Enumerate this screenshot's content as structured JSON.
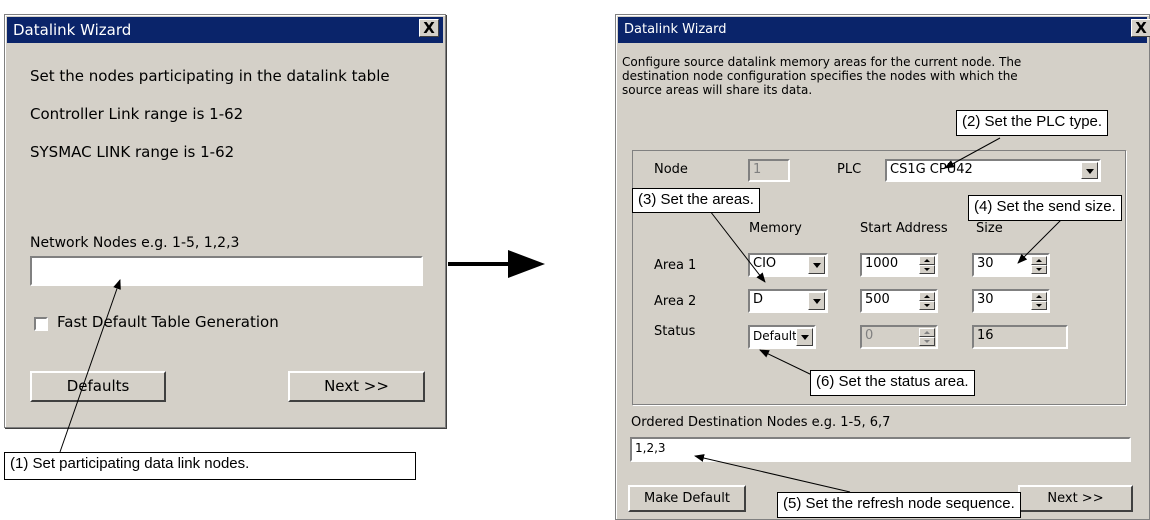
{
  "left_dialog": {
    "title": "Datalink Wizard",
    "close": "X",
    "line1": "Set the nodes participating in the datalink table",
    "line2": "Controller Link range is 1-62",
    "line3": "SYSMAC LINK range is 1-62",
    "network_nodes_label": "Network Nodes  e.g. 1-5, 1,2,3",
    "network_nodes_value": "",
    "fast_default_label": "Fast Default Table Generation",
    "fast_default_checked": false,
    "defaults_button": "Defaults",
    "next_button": "Next  >>"
  },
  "right_dialog": {
    "title": "Datalink Wizard",
    "close": "X",
    "description": [
      "Configure source datalink memory areas for the current node. The",
      "destination node configuration specifies the nodes with which the",
      "source areas will share its data."
    ],
    "node_label": "Node",
    "node_value": "1",
    "plc_label": "PLC",
    "plc_value": "CS1G CPU42",
    "col_memory": "Memory",
    "col_start": "Start Address",
    "col_size": "Size",
    "area1_label": "Area 1",
    "area1_memory": "CIO",
    "area1_start": "1000",
    "area1_size": "30",
    "area2_label": "Area 2",
    "area2_memory": "D",
    "area2_start": "500",
    "area2_size": "30",
    "status_label": "Status",
    "status_memory": "Default",
    "status_start": "0",
    "status_size": "16",
    "ordered_label": "Ordered Destination Nodes  e.g. 1-5, 6,7",
    "ordered_value": "1,2,3",
    "make_default_button": "Make Default",
    "next_button": "Next  >>"
  },
  "callouts": {
    "c1": "(1) Set participating data link nodes.",
    "c2": "(2) Set the PLC type.",
    "c3": "(3) Set the areas.",
    "c4": "(4) Set the send size.",
    "c5": "(5) Set the refresh node sequence.",
    "c6": "(6) Set the status area."
  },
  "colors": {
    "dialog_bg": "#d4d0c8",
    "titlebar": "#0a246a"
  }
}
